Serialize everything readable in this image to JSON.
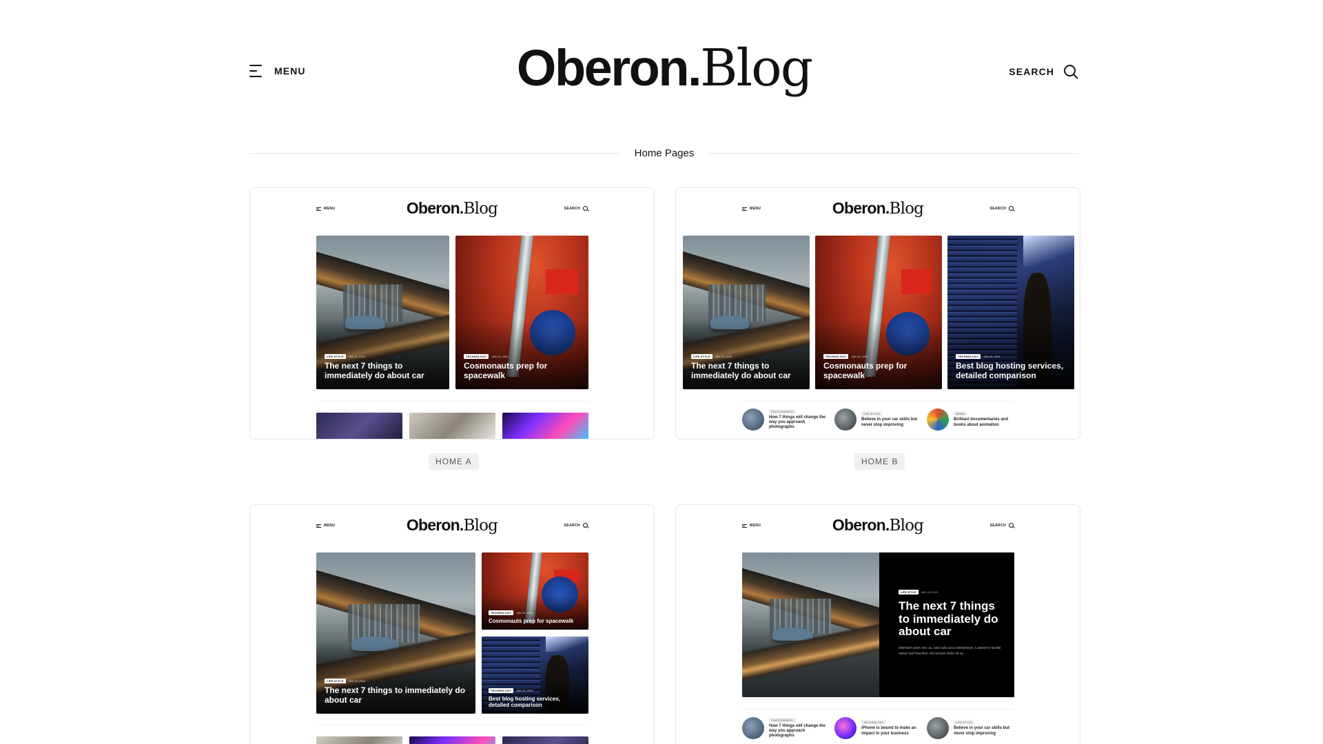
{
  "header": {
    "menu_label": "MENU",
    "logo_part1": "Oberon.",
    "logo_part2": "Blog",
    "search_label": "SEARCH"
  },
  "section": {
    "title": "Home Pages"
  },
  "mini_header": {
    "menu_label": "MENU",
    "logo_part1": "Oberon.",
    "logo_part2": "Blog",
    "search_label": "SEARCH"
  },
  "cards": {
    "a": {
      "label": "HOME A",
      "posts": [
        {
          "tag": "LIFE STYLE",
          "date": "JAN 15, 2023",
          "title": "The next 7 things to immediately do about car"
        },
        {
          "tag": "TECHNOLOGY",
          "date": "JAN 15, 2023",
          "title": "Cosmonauts prep for spacewalk"
        }
      ]
    },
    "b": {
      "label": "HOME B",
      "posts": [
        {
          "tag": "LIFE STYLE",
          "date": "JAN 15, 2023",
          "title": "The next 7 things to immediately do about car"
        },
        {
          "tag": "TECHNOLOGY",
          "date": "JAN 15, 2023",
          "title": "Cosmonauts prep for spacewalk"
        },
        {
          "tag": "TECHNOLOGY",
          "date": "JAN 15, 2023",
          "title": "Best blog hosting services, detailed comparison"
        }
      ],
      "list": [
        {
          "tag": "PHOTOGRAPHY",
          "title": "How 7 things will change the way you approach photographs"
        },
        {
          "tag": "LIFE STYLE",
          "title": "Believe in your car skills but never stop improving"
        },
        {
          "tag": "NEWS",
          "title": "Brilliant documentaries and books about animation"
        }
      ]
    },
    "c": {
      "posts": [
        {
          "tag": "LIFE STYLE",
          "date": "JAN 15, 2023",
          "title": "The next 7 things to immediately do about car"
        },
        {
          "tag": "TECHNOLOGY",
          "date": "JAN 15, 2023",
          "title": "Cosmonauts prep for spacewalk"
        },
        {
          "tag": "TECHNOLOGY",
          "date": "JAN 15, 2023",
          "title": "Best blog hosting services, detailed comparison"
        }
      ]
    },
    "d": {
      "feature": {
        "tag": "LIFE STYLE",
        "date": "JAN 15, 2023",
        "title": "The next 7 things to immediately do about car",
        "excerpt": "Interdum proin nec ac, sed nulla arcu elementum. Laoreet in facilisi varius sed faucibus. Accumsan dolor sit ac."
      },
      "list": [
        {
          "tag": "PHOTOGRAPHY",
          "title": "How 7 things will change the way you approach photographs"
        },
        {
          "tag": "TECHNOLOGY",
          "title": "iPhone is bound to make an impact in your business"
        },
        {
          "tag": "LIFE STYLE",
          "title": "Believe in your car skills but never stop improving"
        }
      ]
    }
  },
  "colors": {
    "text": "#111111",
    "border": "#e6e6e6",
    "label_bg": "#f0f0f0"
  }
}
